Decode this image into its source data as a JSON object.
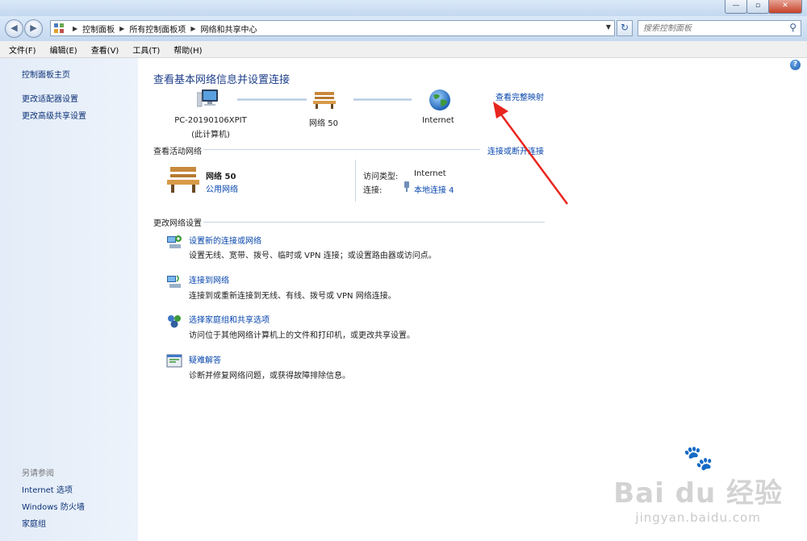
{
  "window": {
    "minimize": "—",
    "maximize": "▫",
    "close": "✕"
  },
  "address_bar": {
    "back": "◀",
    "forward": "▶",
    "breadcrumbs": [
      "控制面板",
      "所有控制面板项",
      "网络和共享中心"
    ],
    "search_placeholder": "搜索控制面板"
  },
  "menu": [
    "文件(F)",
    "编辑(E)",
    "查看(V)",
    "工具(T)",
    "帮助(H)"
  ],
  "sidebar": {
    "links": [
      "控制面板主页",
      "更改适配器设置",
      "更改高级共享设置"
    ],
    "see_also_title": "另请参阅",
    "see_also": [
      "Internet 选项",
      "Windows 防火墙",
      "家庭组"
    ]
  },
  "main": {
    "title": "查看基本网络信息并设置连接",
    "view_full_map": "查看完整映射",
    "map": {
      "computer_name": "PC-20190106XPIT",
      "computer_sub": "(此计算机)",
      "network_name": "网络  50",
      "internet": "Internet"
    },
    "active_networks": {
      "title": "查看活动网络",
      "connect_disconnect": "连接或断开连接",
      "network_name": "网络  50",
      "network_type": "公用网络",
      "access_type_label": "访问类型:",
      "access_type_value": "Internet",
      "connection_label": "连接:",
      "connection_value": "本地连接 4"
    },
    "change_settings": {
      "title": "更改网络设置",
      "tasks": [
        {
          "title": "设置新的连接或网络",
          "desc": "设置无线、宽带、拨号、临时或 VPN 连接；或设置路由器或访问点。"
        },
        {
          "title": "连接到网络",
          "desc": "连接到或重新连接到无线、有线、拨号或 VPN 网络连接。"
        },
        {
          "title": "选择家庭组和共享选项",
          "desc": "访问位于其他网络计算机上的文件和打印机，或更改共享设置。"
        },
        {
          "title": "疑难解答",
          "desc": "诊断并修复网络问题，或获得故障排除信息。"
        }
      ]
    }
  },
  "watermark": {
    "brand": "Bai du 经验",
    "url": "jingyan.baidu.com"
  },
  "colors": {
    "link": "#0645ad",
    "heading": "#1e3f8a",
    "sidebar_link": "#0c3276",
    "annotation_arrow": "#e8261f"
  }
}
